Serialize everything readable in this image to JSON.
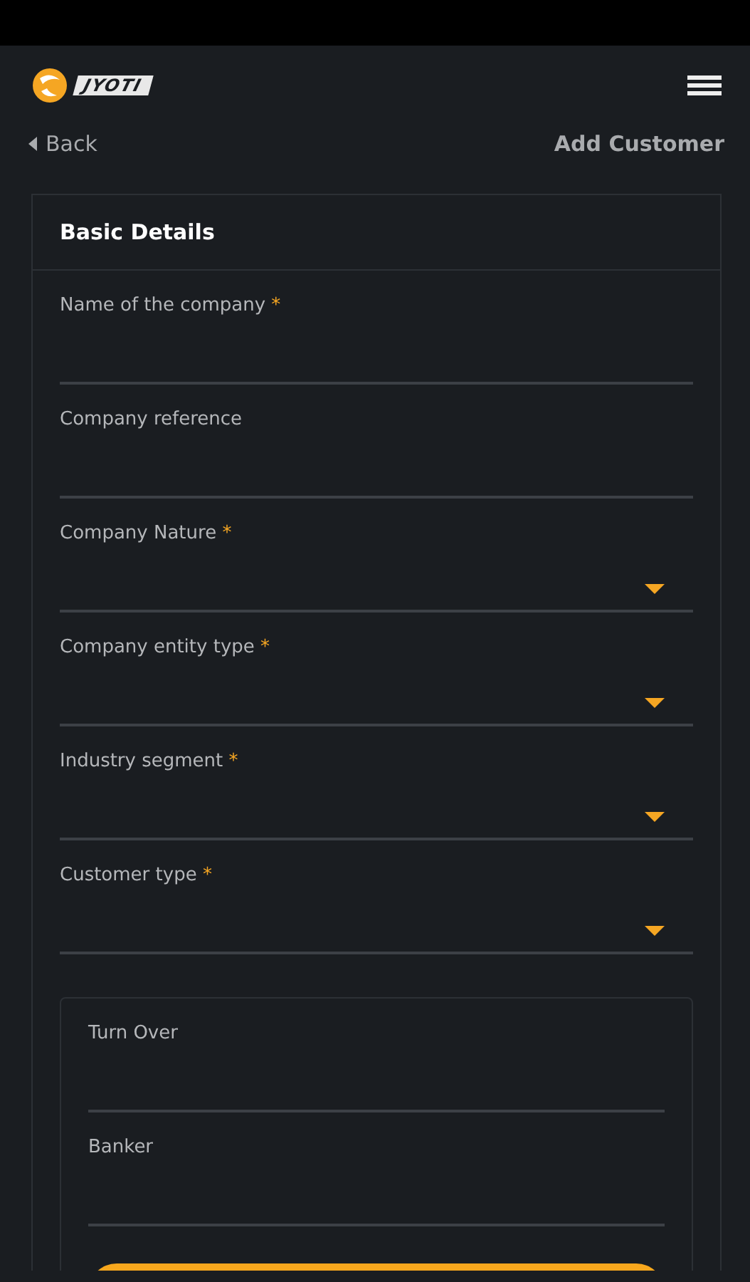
{
  "header": {
    "logo_text": "JYOTI"
  },
  "nav": {
    "back": "Back",
    "title": "Add Customer"
  },
  "required_marker": "*",
  "card": {
    "title": "Basic Details",
    "fields": [
      {
        "label": "Name of the company",
        "kind": "text",
        "required": true
      },
      {
        "label": "Company reference",
        "kind": "text",
        "required": false
      },
      {
        "label": "Company Nature",
        "kind": "select",
        "required": true
      },
      {
        "label": "Company entity type",
        "kind": "select",
        "required": true
      },
      {
        "label": "Industry segment",
        "kind": "select",
        "required": true
      },
      {
        "label": "Customer type",
        "kind": "select",
        "required": true
      }
    ],
    "sub_fields": [
      {
        "label": "Turn Over",
        "required": false
      },
      {
        "label": "Banker",
        "required": false
      }
    ]
  }
}
